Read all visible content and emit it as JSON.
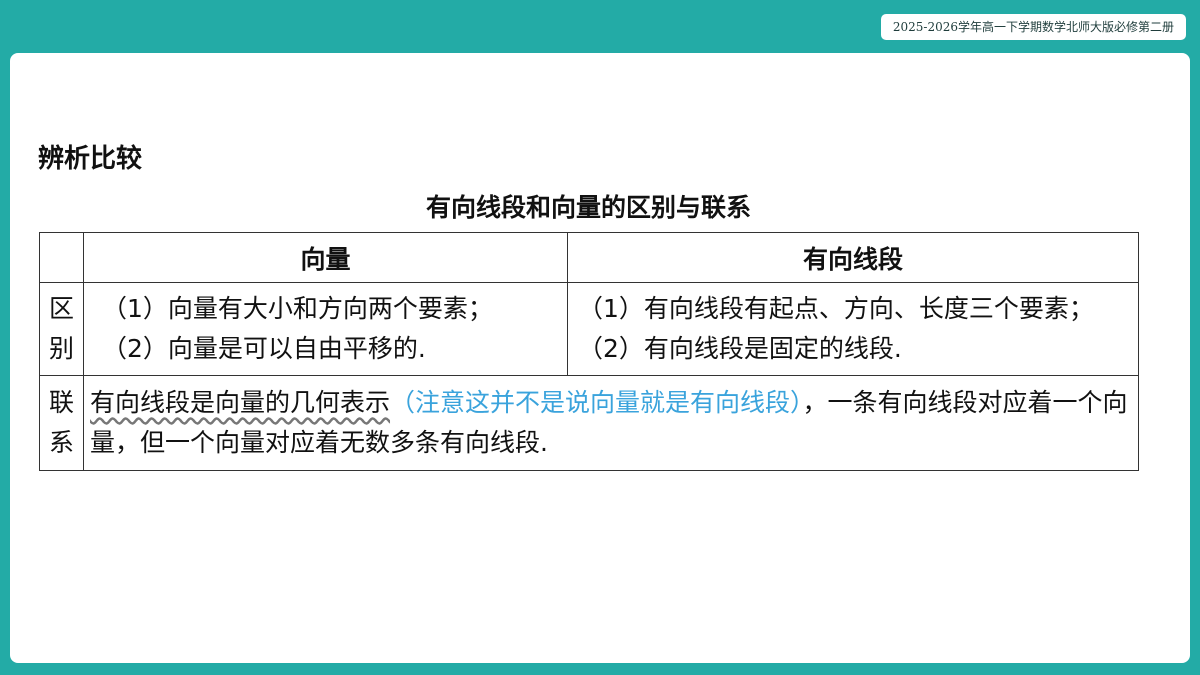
{
  "badge": "2025-2026学年高一下学期数学北师大版必修第二册",
  "section_title": "辨析比较",
  "table_title": "有向线段和向量的区别与联系",
  "table": {
    "header": [
      "",
      "向量",
      "有向线段"
    ],
    "row1": {
      "side_1": "区",
      "side_2": "别",
      "vector_line1": "（1）向量有大小和方向两个要素；",
      "vector_line2": "（2）向量是可以自由平移的.",
      "segment_text": "（1）有向线段有起点、方向、长度三个要素；（2）有向线段是固定的线段."
    },
    "row2": {
      "side_1": "联",
      "side_2": "系",
      "underlined": "有向线段是向量的几何表示",
      "note": "（注意这并不是说向量就是有向线段）",
      "rest": "，一条有向线段对应着一个向量，但一个向量对应着无数多条有向线段."
    }
  }
}
